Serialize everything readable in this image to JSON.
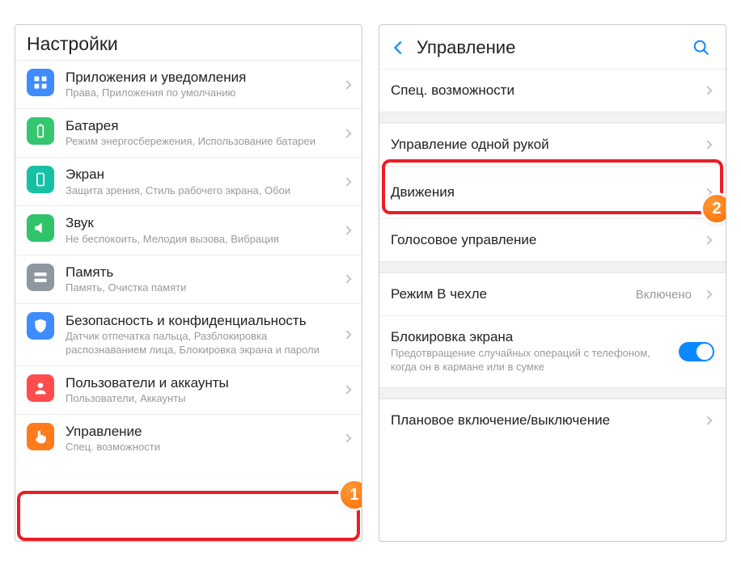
{
  "left": {
    "header": "Настройки",
    "items": [
      {
        "title": "Приложения и уведомления",
        "sub": "Права, Приложения по умолчанию",
        "color": "#3f8cff",
        "icon": "apps"
      },
      {
        "title": "Батарея",
        "sub": "Режим энергосбережения, Использование батареи",
        "color": "#35c770",
        "icon": "battery"
      },
      {
        "title": "Экран",
        "sub": "Защита зрения, Стиль рабочего экрана, Обои",
        "color": "#16c0a3",
        "icon": "screen"
      },
      {
        "title": "Звук",
        "sub": "Не беспокоить, Мелодия вызова, Вибрация",
        "color": "#2fc46a",
        "icon": "sound"
      },
      {
        "title": "Память",
        "sub": "Память, Очистка памяти",
        "color": "#9097a0",
        "icon": "storage"
      },
      {
        "title": "Безопасность и конфиденциальность",
        "sub": "Датчик отпечатка пальца, Разблокировка распознаванием лица, Блокировка экрана и пароли",
        "color": "#3f8cff",
        "icon": "shield"
      },
      {
        "title": "Пользователи и аккаунты",
        "sub": "Пользователи, Аккаунты",
        "color": "#ff4d4d",
        "icon": "user"
      },
      {
        "title": "Управление",
        "sub": "Спец. возможности",
        "color": "#ff7a1a",
        "icon": "hand"
      }
    ],
    "badge": "1"
  },
  "right": {
    "header": "Управление",
    "items": [
      {
        "label": "Спец. возможности"
      },
      {
        "label": "Управление одной рукой"
      },
      {
        "label": "Движения"
      },
      {
        "label": "Голосовое управление"
      }
    ],
    "case_mode": {
      "label": "Режим В чехле",
      "value": "Включено"
    },
    "screen_lock": {
      "label": "Блокировка экрана",
      "desc": "Предотвращение случайных операций с телефоном, когда он в кармане или в сумке",
      "on": true
    },
    "scheduled": {
      "label": "Плановое включение/выключение"
    },
    "badge": "2"
  }
}
